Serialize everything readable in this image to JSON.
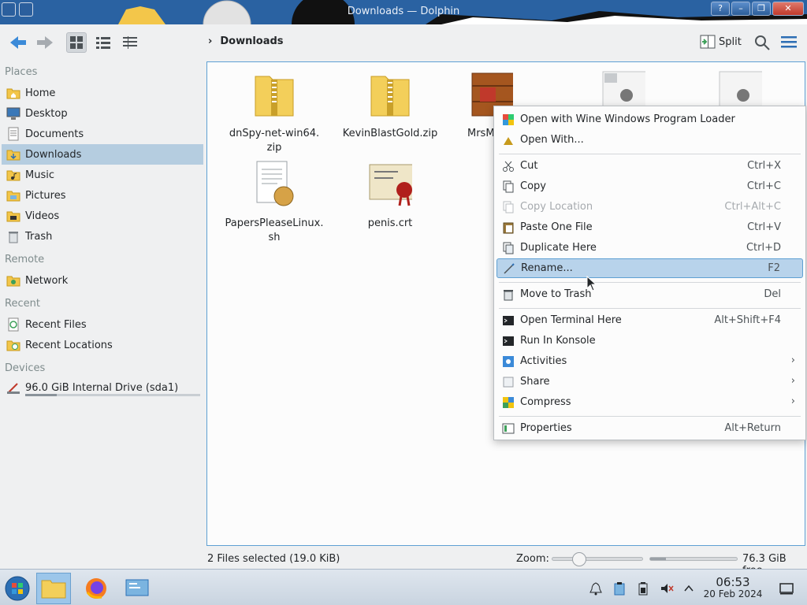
{
  "window": {
    "title": "Downloads — Dolphin",
    "help_label": "?",
    "minimize_label": "–",
    "maximize_label": "❐",
    "close_label": "✕"
  },
  "toolbar": {
    "breadcrumb": "Downloads",
    "split_label": "Split"
  },
  "sidebar": {
    "sections": {
      "places": "Places",
      "remote": "Remote",
      "recent": "Recent",
      "devices": "Devices"
    },
    "places": [
      {
        "label": "Home",
        "icon": "home-folder-icon"
      },
      {
        "label": "Desktop",
        "icon": "desktop-icon"
      },
      {
        "label": "Documents",
        "icon": "documents-icon"
      },
      {
        "label": "Downloads",
        "icon": "downloads-folder-icon",
        "selected": true
      },
      {
        "label": "Music",
        "icon": "music-folder-icon"
      },
      {
        "label": "Pictures",
        "icon": "pictures-folder-icon"
      },
      {
        "label": "Videos",
        "icon": "videos-folder-icon"
      },
      {
        "label": "Trash",
        "icon": "trash-icon"
      }
    ],
    "remote": [
      {
        "label": "Network",
        "icon": "network-icon"
      }
    ],
    "recent": [
      {
        "label": "Recent Files",
        "icon": "recent-files-icon"
      },
      {
        "label": "Recent Locations",
        "icon": "recent-locations-icon"
      }
    ],
    "devices": [
      {
        "label": "96.0 GiB Internal Drive (sda1)",
        "icon": "hard-drive-icon",
        "usage_fraction": 0.18
      }
    ]
  },
  "files": [
    {
      "name": "dnSpy-net-win64.\nzip",
      "icon": "zip-folder-icon"
    },
    {
      "name": "KevinBlastGold.zip",
      "icon": "zip-folder-icon"
    },
    {
      "name": "MrsM",
      "icon": "7zip-archive-icon"
    },
    {
      "name": "",
      "icon": "executable-icon"
    },
    {
      "name": "",
      "icon": "executable-icon"
    },
    {
      "name": "PapersPleaseLinux.\nsh",
      "icon": "script-file-icon"
    },
    {
      "name": "penis.crt",
      "icon": "certificate-icon"
    }
  ],
  "context_menu": {
    "items": [
      {
        "label": "Open with Wine Windows Program Loader",
        "shortcut": "",
        "icon": "wine-icon"
      },
      {
        "label": "Open With...",
        "shortcut": "",
        "icon": "open-with-icon"
      },
      {
        "label": "Cut",
        "shortcut": "Ctrl+X",
        "icon": "scissors-icon"
      },
      {
        "label": "Copy",
        "shortcut": "Ctrl+C",
        "icon": "copy-icon"
      },
      {
        "label": "Copy Location",
        "shortcut": "Ctrl+Alt+C",
        "icon": "copy-location-icon",
        "disabled": true
      },
      {
        "label": "Paste One File",
        "shortcut": "Ctrl+V",
        "icon": "paste-icon"
      },
      {
        "label": "Duplicate Here",
        "shortcut": "Ctrl+D",
        "icon": "duplicate-icon"
      },
      {
        "label": "Rename...",
        "shortcut": "F2",
        "icon": "rename-icon",
        "highlighted": true
      },
      {
        "label": "Move to Trash",
        "shortcut": "Del",
        "icon": "trash-icon"
      },
      {
        "label": "Open Terminal Here",
        "shortcut": "Alt+Shift+F4",
        "icon": "terminal-icon"
      },
      {
        "label": "Run In Konsole",
        "shortcut": "",
        "icon": "konsole-icon"
      },
      {
        "label": "Activities",
        "shortcut": "",
        "icon": "activities-icon",
        "submenu": true
      },
      {
        "label": "Share",
        "shortcut": "",
        "icon": "share-icon",
        "submenu": true
      },
      {
        "label": "Compress",
        "shortcut": "",
        "icon": "compress-icon",
        "submenu": true
      },
      {
        "label": "Properties",
        "shortcut": "Alt+Return",
        "icon": "properties-icon"
      }
    ],
    "submenu_arrow": "›"
  },
  "statusbar": {
    "selection": "2 Files selected (19.0 KiB)",
    "zoom_label": "Zoom:",
    "zoom_fraction": 0.25,
    "free_space": "76.3 GiB free",
    "used_fraction": 0.18
  },
  "taskbar": {
    "time": "06:53",
    "date": "20 Feb 2024"
  },
  "colors": {
    "selection": "#b5cde0",
    "highlight": "#b8d3eb",
    "accent": "#5fa0d3"
  }
}
